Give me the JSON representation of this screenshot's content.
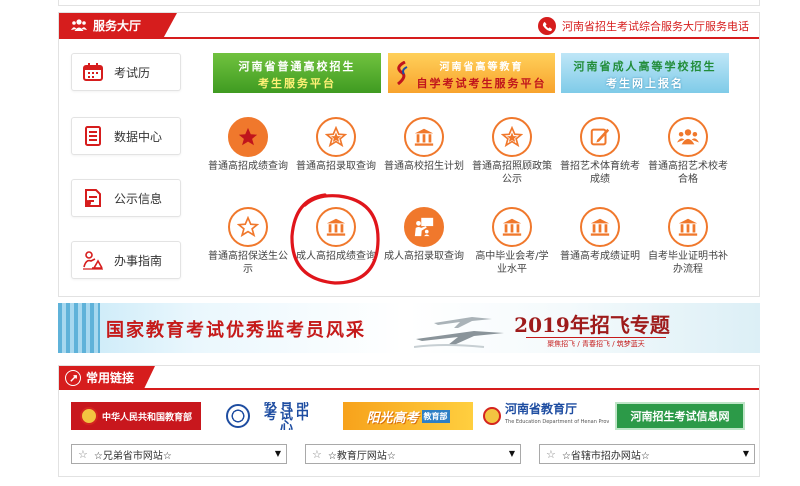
{
  "hall": {
    "title": "服务大厅",
    "phone_text": "河南省招生考试综合服务大厅服务电话"
  },
  "side_menu": [
    {
      "label": "考试历",
      "icon": "calendar-icon"
    },
    {
      "label": "数据中心",
      "icon": "document-list-icon"
    },
    {
      "label": "公示信息",
      "icon": "bulletin-icon"
    },
    {
      "label": "办事指南",
      "icon": "guide-person-icon"
    }
  ],
  "banners": [
    {
      "line1": "河南省普通高校招生",
      "line2": "考生服务平台"
    },
    {
      "line1": "河南省高等教育",
      "line2": "自学考试考生服务平台"
    },
    {
      "line1": "河南省成人高等学校招生",
      "line2": "考生网上报名"
    }
  ],
  "services": [
    {
      "label": "普通高招成绩查询",
      "icon": "star-icon",
      "solid": true
    },
    {
      "label": "普通高招录取查询",
      "icon": "star-icon",
      "solid": false
    },
    {
      "label": "普通高校招生计划",
      "icon": "building-icon",
      "solid": false
    },
    {
      "label": "普通高招照顾政策公示",
      "icon": "star-icon",
      "solid": false
    },
    {
      "label": "普招艺术体育统考成绩",
      "icon": "edit-icon",
      "solid": false
    },
    {
      "label": "普通高招艺术校考合格",
      "icon": "group-icon",
      "solid": false
    },
    {
      "label": "普通高招保送生公示",
      "icon": "star-outline-icon",
      "solid": false
    },
    {
      "label": "成人高招成绩查询",
      "icon": "building-icon",
      "solid": false
    },
    {
      "label": "成人高招录取查询",
      "icon": "presentation-icon",
      "solid": true
    },
    {
      "label": "高中毕业会考/学业水平",
      "icon": "building-icon",
      "solid": false
    },
    {
      "label": "普通高考成绩证明",
      "icon": "building-icon",
      "solid": false
    },
    {
      "label": "自考毕业证明书补办流程",
      "icon": "building-icon",
      "solid": false
    }
  ],
  "wide_banners": {
    "left_text": "国家教育考试优秀监考员风采",
    "right_title": "2019年招飞专题",
    "right_sub": "聚焦招飞 / 青春招飞 / 筑梦蓝天"
  },
  "links": {
    "title": "常用链接",
    "logos": [
      {
        "text": "中华人民共和国教育部"
      },
      {
        "text": "教育部考试中心"
      },
      {
        "text": "阳光高考",
        "sub": "教育部"
      },
      {
        "text": "河南省教育厅",
        "en": "The Education Department of Henan Province"
      },
      {
        "text": "河南招生考试信息网"
      }
    ],
    "selects": [
      {
        "label": "☆兄弟省市网站☆"
      },
      {
        "label": "☆教育厅网站☆"
      },
      {
        "label": "☆省辖市招办网站☆"
      }
    ]
  },
  "colors": {
    "brand_red": "#d61d1d",
    "icon_orange": "#f0782c",
    "annotation_red": "#e0151b"
  }
}
